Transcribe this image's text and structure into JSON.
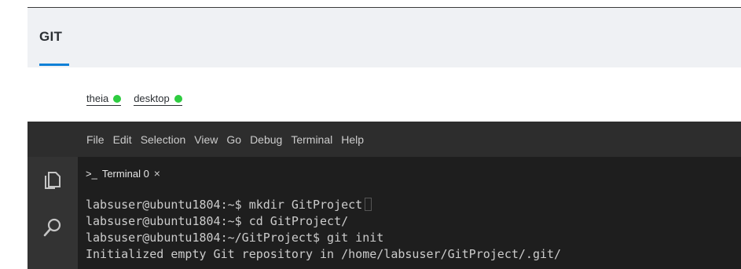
{
  "header": {
    "title": "GIT"
  },
  "env_tabs": [
    {
      "label": "theia",
      "status_color": "#2ecc40"
    },
    {
      "label": "desktop",
      "status_color": "#2ecc40"
    }
  ],
  "menubar": {
    "items": [
      "File",
      "Edit",
      "Selection",
      "View",
      "Go",
      "Debug",
      "Terminal",
      "Help"
    ]
  },
  "activity_bar": {
    "icons": [
      "files-icon",
      "search-icon"
    ]
  },
  "terminal": {
    "tab_label": "Terminal 0",
    "tab_icon": ">_",
    "close_glyph": "×",
    "lines": [
      "labsuser@ubuntu1804:~$ mkdir GitProject",
      "labsuser@ubuntu1804:~$ cd GitProject/",
      "labsuser@ubuntu1804:~/GitProject$ git init",
      "Initialized empty Git repository in /home/labsuser/GitProject/.git/"
    ]
  }
}
